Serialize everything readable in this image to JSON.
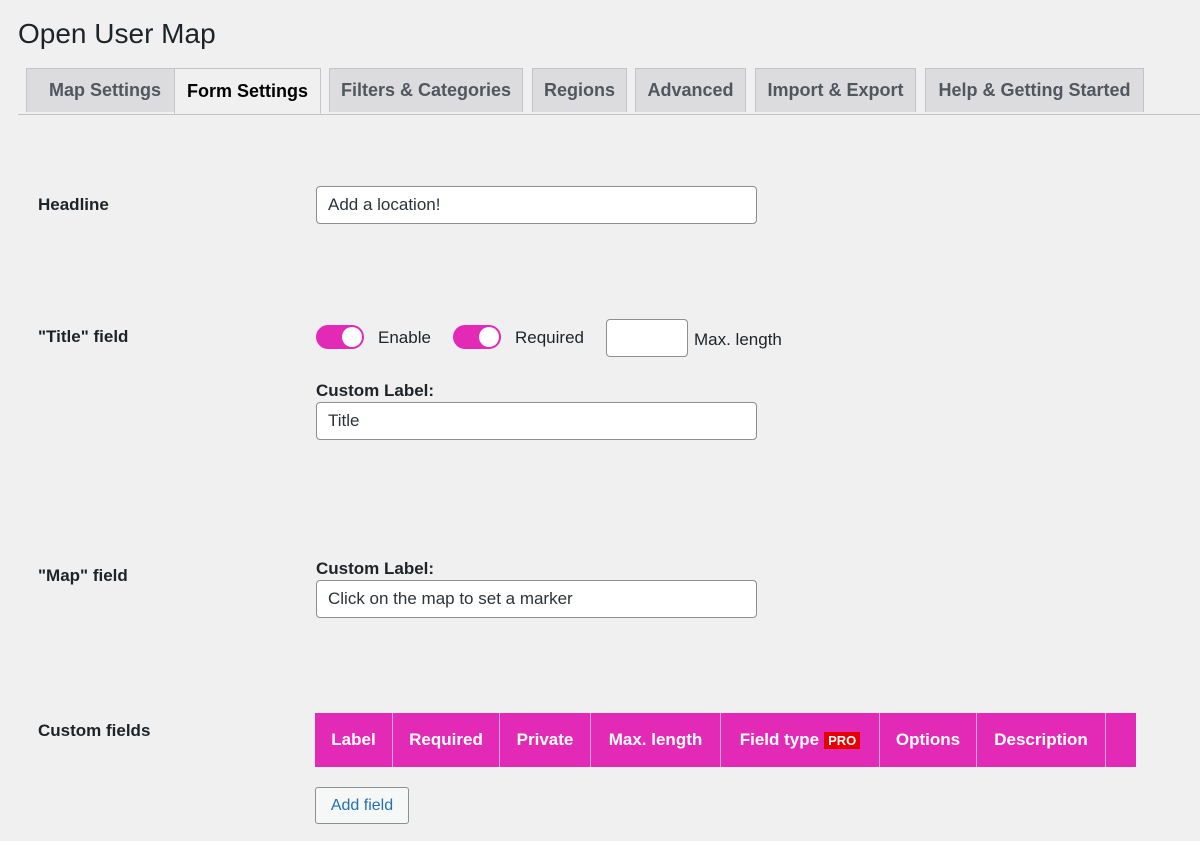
{
  "page": {
    "title": "Open User Map"
  },
  "tabs": [
    {
      "label": "Map Settings",
      "active": false
    },
    {
      "label": "Form Settings",
      "active": true
    },
    {
      "label": "Filters & Categories",
      "active": false
    },
    {
      "label": "Regions",
      "active": false
    },
    {
      "label": "Advanced",
      "active": false
    },
    {
      "label": "Import & Export",
      "active": false
    },
    {
      "label": "Help & Getting Started",
      "active": false
    }
  ],
  "headline": {
    "label": "Headline",
    "value": "Add a location!"
  },
  "title_field": {
    "label": "\"Title\" field",
    "enable_label": "Enable",
    "enable_on": true,
    "required_label": "Required",
    "required_on": true,
    "max_length_value": "",
    "max_length_label": "Max. length",
    "custom_label_caption": "Custom Label:",
    "custom_label_value": "Title"
  },
  "map_field": {
    "label": "\"Map\" field",
    "custom_label_caption": "Custom Label:",
    "custom_label_value": "Click on the map to set a marker"
  },
  "custom_fields": {
    "label": "Custom fields",
    "columns": {
      "label": "Label",
      "required": "Required",
      "private": "Private",
      "max_length": "Max. length",
      "field_type": "Field type",
      "field_type_badge": "PRO",
      "options": "Options",
      "description": "Description"
    },
    "add_button": "Add field"
  },
  "colors": {
    "accent": "#e22ab6",
    "pro_badge": "#e60000",
    "link": "#2271b1"
  }
}
